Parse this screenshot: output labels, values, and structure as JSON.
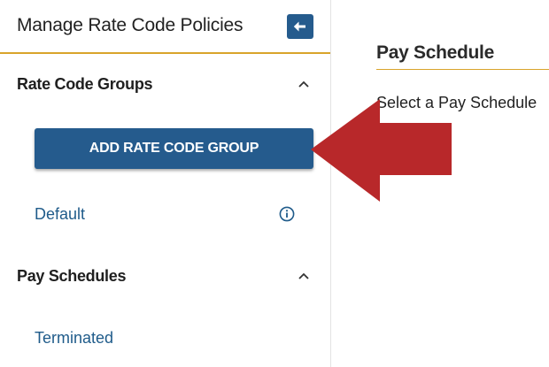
{
  "sidebar": {
    "title": "Manage Rate Code Policies",
    "collapse_icon": "arrow-left-icon",
    "sections": [
      {
        "title": "Rate Code Groups",
        "expanded": true,
        "add_button": "ADD RATE CODE GROUP",
        "items": [
          "Default"
        ]
      },
      {
        "title": "Pay Schedules",
        "expanded": true,
        "items": [
          "Terminated"
        ]
      }
    ]
  },
  "main": {
    "title": "Pay Schedule",
    "message": "Select a Pay Schedule"
  },
  "colors": {
    "primary": "#255b8d",
    "accent_rule": "#d9a42a",
    "link": "#1f5b8a",
    "annotation_arrow": "#b8282a"
  }
}
